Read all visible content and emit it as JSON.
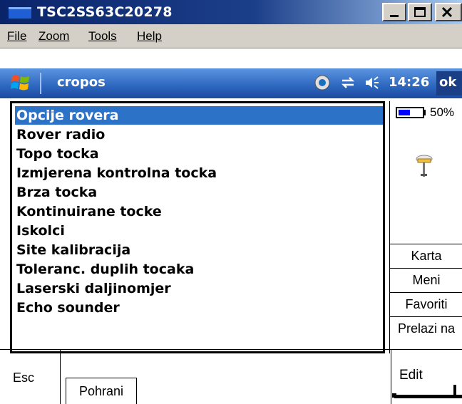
{
  "window": {
    "title": "TSC2SS63C20278",
    "controls": [
      "minimize",
      "maximize",
      "close"
    ]
  },
  "menu": {
    "items": [
      {
        "label": "File",
        "accel": "F"
      },
      {
        "label": "Zoom",
        "accel": "Z"
      },
      {
        "label": "Tools",
        "accel": "T"
      },
      {
        "label": "Help",
        "accel": "H"
      }
    ]
  },
  "taskbar": {
    "app_name": "cropos",
    "time": "14:26",
    "ok_label": "ok",
    "icons": [
      "start-flag-icon",
      "network-icon",
      "sync-arrows-icon",
      "speaker-icon"
    ]
  },
  "list": {
    "items": [
      {
        "label": "Opcije rovera",
        "selected": true
      },
      {
        "label": "Rover radio",
        "selected": false
      },
      {
        "label": "Topo tocka",
        "selected": false
      },
      {
        "label": "Izmjerena kontrolna tocka",
        "selected": false
      },
      {
        "label": "Brza tocka",
        "selected": false
      },
      {
        "label": "Kontinuirane tocke",
        "selected": false
      },
      {
        "label": "Iskolci",
        "selected": false
      },
      {
        "label": "Site kalibracija",
        "selected": false
      },
      {
        "label": "Toleranc. duplih tocaka",
        "selected": false
      },
      {
        "label": "Laserski daljinomjer",
        "selected": false
      },
      {
        "label": "Echo sounder",
        "selected": false
      }
    ],
    "selection_color": "#2c72c7"
  },
  "side_panel": {
    "battery_pct": "50%",
    "battery_level": 0.5,
    "buttons": [
      "Karta",
      "Meni",
      "Favoriti",
      "Prelazi na"
    ]
  },
  "bottom": {
    "esc": "Esc",
    "pohrani": "Pohrani",
    "edit": "Edit"
  }
}
